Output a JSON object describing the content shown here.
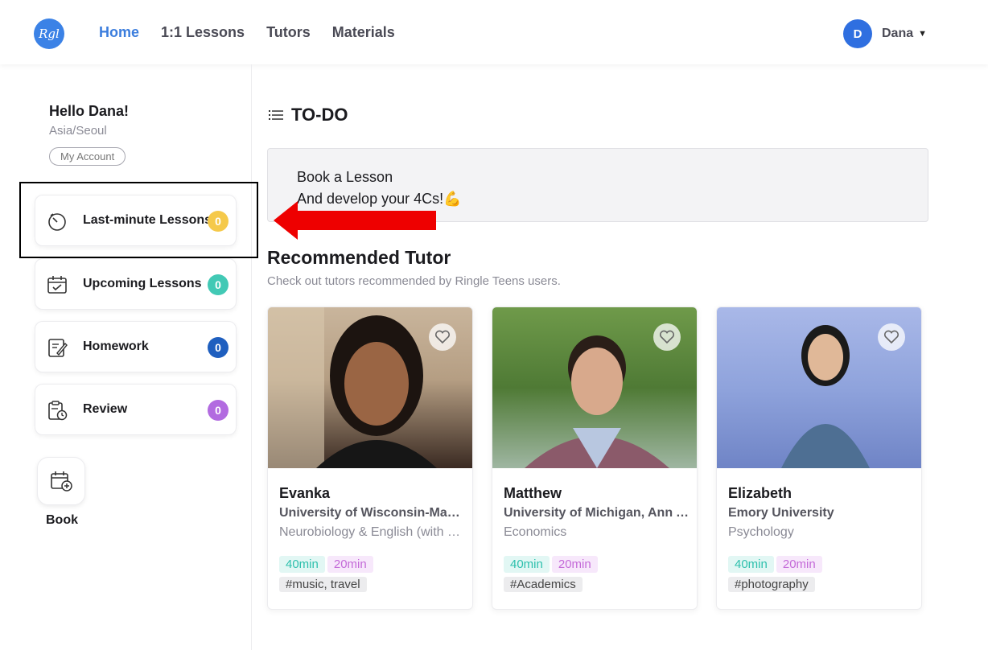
{
  "header": {
    "nav": [
      "Home",
      "1:1 Lessons",
      "Tutors",
      "Materials"
    ],
    "active_index": 0,
    "user_initial": "D",
    "user_name": "Dana"
  },
  "sidebar": {
    "hello": "Hello Dana!",
    "timezone": "Asia/Seoul",
    "account_button": "My Account",
    "items": [
      {
        "label": "Last-minute Lessons",
        "count": "0",
        "color": "#f5c94a",
        "icon": "timer-icon"
      },
      {
        "label": "Upcoming Lessons",
        "count": "0",
        "color": "#42c9b5",
        "icon": "calendar-check-icon"
      },
      {
        "label": "Homework",
        "count": "0",
        "color": "#1f5fbf",
        "icon": "notepad-pencil-icon"
      },
      {
        "label": "Review",
        "count": "0",
        "color": "#b26be0",
        "icon": "clipboard-clock-icon"
      }
    ],
    "book_label": "Book"
  },
  "todo": {
    "title": "TO-DO",
    "line1": "Book a Lesson",
    "line2": "And develop your 4Cs!💪"
  },
  "recommended": {
    "title": "Recommended Tutor",
    "subtitle": "Check out tutors recommended by Ringle Teens users.",
    "tutors": [
      {
        "name": "Evanka",
        "university": "University of Wisconsin-Madison",
        "major": "Neurobiology & English (with Honors)",
        "dur1": "40min",
        "dur2": "20min",
        "tag": "#music, travel"
      },
      {
        "name": "Matthew",
        "university": "University of Michigan, Ann Arbor",
        "major": "Economics",
        "dur1": "40min",
        "dur2": "20min",
        "tag": "#Academics"
      },
      {
        "name": "Elizabeth",
        "university": "Emory University",
        "major": "Psychology",
        "dur1": "40min",
        "dur2": "20min",
        "tag": "#photography"
      }
    ]
  }
}
